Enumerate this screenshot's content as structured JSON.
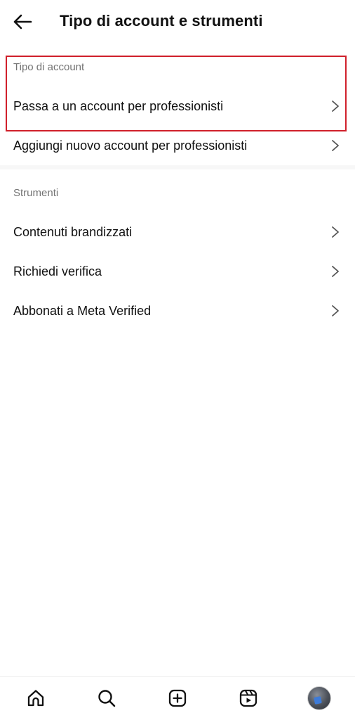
{
  "header": {
    "title": "Tipo di account e strumenti",
    "back_icon": "arrow-left-icon"
  },
  "sections": [
    {
      "label": "Tipo di account",
      "items": [
        {
          "label": "Passa a un account per professionisti",
          "icon": "chevron-right-icon"
        },
        {
          "label": "Aggiungi nuovo account per professionisti",
          "icon": "chevron-right-icon"
        }
      ]
    },
    {
      "label": "Strumenti",
      "items": [
        {
          "label": "Contenuti brandizzati",
          "icon": "chevron-right-icon"
        },
        {
          "label": "Richiedi verifica",
          "icon": "chevron-right-icon"
        },
        {
          "label": "Abbonati a Meta Verified",
          "icon": "chevron-right-icon"
        }
      ]
    }
  ],
  "highlight": {
    "color": "#d0202b"
  },
  "bottom_nav": {
    "items": [
      "home-icon",
      "search-icon",
      "create-post-icon",
      "reels-icon",
      "profile-avatar"
    ]
  }
}
